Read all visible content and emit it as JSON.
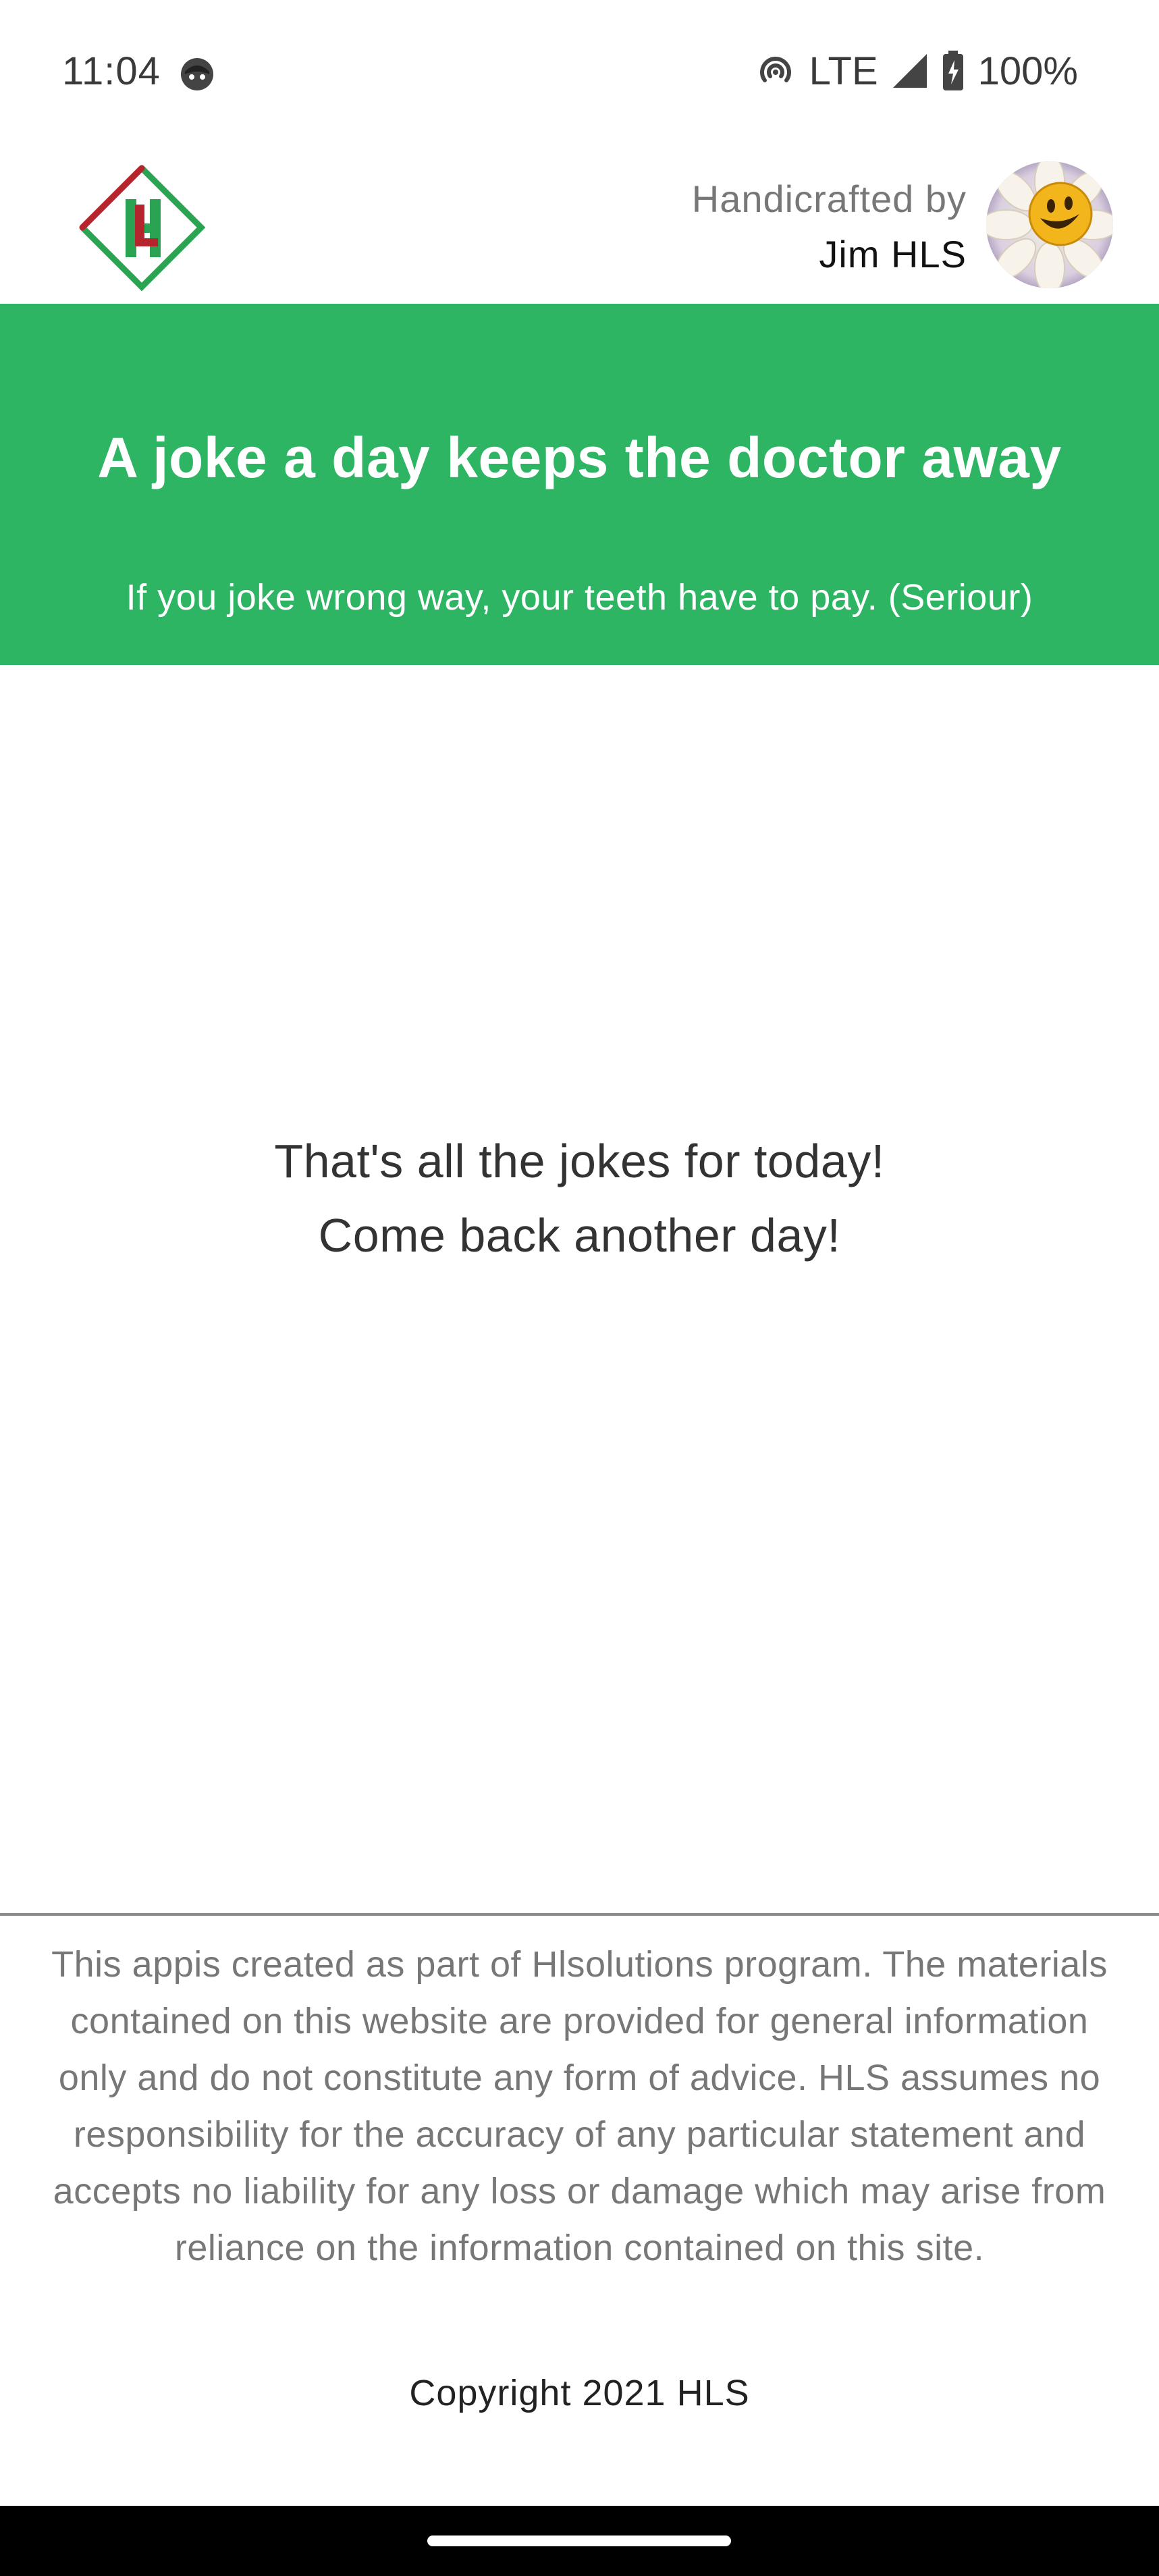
{
  "status_bar": {
    "time": "11:04",
    "network": "LTE",
    "battery": "100%"
  },
  "header": {
    "credit_label": "Handicrafted by",
    "credit_name": "Jim HLS"
  },
  "banner": {
    "title": "A joke a day keeps the doctor away",
    "subtitle": "If you joke wrong way, your teeth have to pay. (Seriour)"
  },
  "main": {
    "message_line1": "That's all the jokes for today!",
    "message_line2": "Come back another day!"
  },
  "footer": {
    "disclaimer": "This appis created as part of Hlsolutions program. The materials contained on this website are provided for general information only and do not constitute any form of advice. HLS assumes no responsibility for the accuracy of any particular statement and accepts no liability for any loss or damage which may arise from reliance on the information contained on this site.",
    "copyright": "Copyright 2021 HLS"
  },
  "colors": {
    "banner": "#2db564",
    "logo_red": "#b5252e",
    "logo_green": "#2aa352"
  }
}
